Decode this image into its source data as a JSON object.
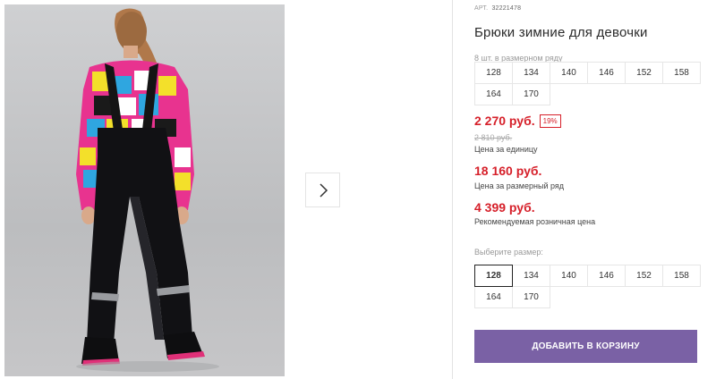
{
  "colors": {
    "accent": "#7a61a5",
    "price_red": "#d6202a"
  },
  "gallery": {
    "next_icon": "chevron-right-icon"
  },
  "product": {
    "sku_label": "АРТ.",
    "sku_value": "32221478",
    "title": "Брюки зимние для девочки",
    "pack_label": "8 шт. в размерном ряду",
    "pack_sizes": [
      "128",
      "134",
      "140",
      "146",
      "152",
      "158",
      "164",
      "170"
    ],
    "price": "2 270 руб.",
    "discount": "19%",
    "old_price": "2 810 руб.",
    "unit_price_label": "Цена за единицу",
    "pack_price": "18 160 руб.",
    "pack_price_label": "Цена за размерный ряд",
    "retail_price": "4 399 руб.",
    "retail_price_label": "Рекомендуемая розничная цена",
    "size_select_label": "Выберите размер:",
    "size_options": [
      "128",
      "134",
      "140",
      "146",
      "152",
      "158",
      "164",
      "170"
    ],
    "selected_size": "128",
    "add_to_cart": "ДОБАВИТЬ В КОРЗИНУ"
  }
}
